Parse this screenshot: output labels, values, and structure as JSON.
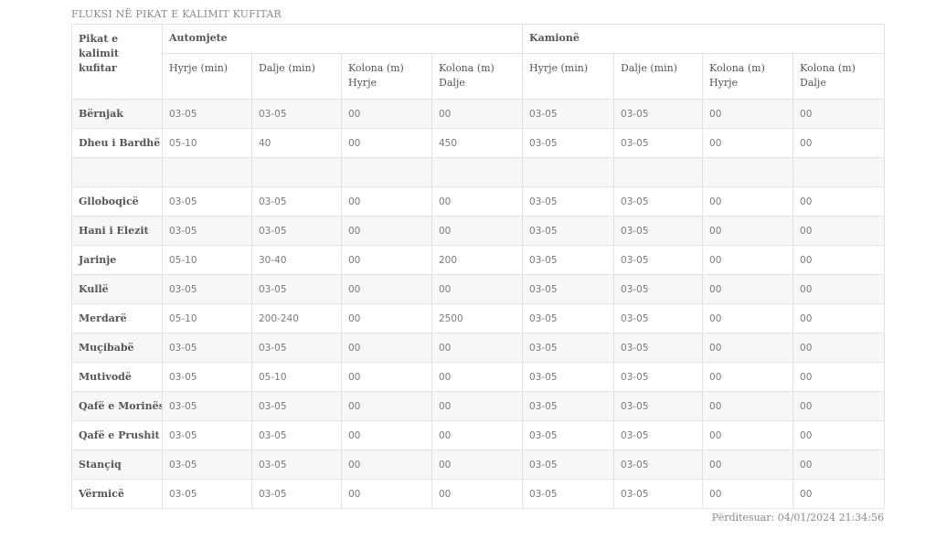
{
  "title": "FLUKSI NË PIKAT E KALIMIT KUFITAR",
  "header": {
    "row_label": "Pikat e kalimit kufitar",
    "group_cars": "Automjete",
    "group_trucks": "Kamionë",
    "cols": [
      "Hyrje (min)",
      "Dalje (min)",
      "Kolona (m) Hyrje",
      "Kolona (m) Dalje",
      "Hyrje (min)",
      "Dalje (min)",
      "Kolona (m) Hyrje",
      "Kolona (m) Dalje"
    ]
  },
  "rows": [
    {
      "name": "Bërnjak",
      "values": [
        "03-05",
        "03-05",
        "00",
        "00",
        "03-05",
        "03-05",
        "00",
        "00"
      ]
    },
    {
      "name": "Dheu i Bardhë",
      "values": [
        "05-10",
        "40",
        "00",
        "450",
        "03-05",
        "03-05",
        "00",
        "00"
      ]
    },
    {
      "name": "",
      "values": [
        "",
        "",
        "",
        "",
        "",
        "",
        "",
        ""
      ]
    },
    {
      "name": "Glloboqicë",
      "values": [
        "03-05",
        "03-05",
        "00",
        "00",
        "03-05",
        "03-05",
        "00",
        "00"
      ]
    },
    {
      "name": "Hani i Elezit",
      "values": [
        "03-05",
        "03-05",
        "00",
        "00",
        "03-05",
        "03-05",
        "00",
        "00"
      ]
    },
    {
      "name": "Jarinje",
      "values": [
        "05-10",
        "30-40",
        "00",
        "200",
        "03-05",
        "03-05",
        "00",
        "00"
      ]
    },
    {
      "name": "Kullë",
      "values": [
        "03-05",
        "03-05",
        "00",
        "00",
        "03-05",
        "03-05",
        "00",
        "00"
      ]
    },
    {
      "name": "Merdarë",
      "values": [
        "05-10",
        "200-240",
        "00",
        "2500",
        "03-05",
        "03-05",
        "00",
        "00"
      ]
    },
    {
      "name": "Muçibabë",
      "values": [
        "03-05",
        "03-05",
        "00",
        "00",
        "03-05",
        "03-05",
        "00",
        "00"
      ]
    },
    {
      "name": "Mutivodë",
      "values": [
        "03-05",
        "05-10",
        "00",
        "00",
        "03-05",
        "03-05",
        "00",
        "00"
      ]
    },
    {
      "name": "Qafë e Morinës",
      "values": [
        "03-05",
        "03-05",
        "00",
        "00",
        "03-05",
        "03-05",
        "00",
        "00"
      ]
    },
    {
      "name": "Qafë e Prushit",
      "values": [
        "03-05",
        "03-05",
        "00",
        "00",
        "03-05",
        "03-05",
        "00",
        "00"
      ]
    },
    {
      "name": "Stançiq",
      "values": [
        "03-05",
        "03-05",
        "00",
        "00",
        "03-05",
        "03-05",
        "00",
        "00"
      ]
    },
    {
      "name": "Vërmicë",
      "values": [
        "03-05",
        "03-05",
        "00",
        "00",
        "03-05",
        "03-05",
        "00",
        "00"
      ]
    }
  ],
  "updated": "Përditesuar: 04/01/2024 21:34:56"
}
